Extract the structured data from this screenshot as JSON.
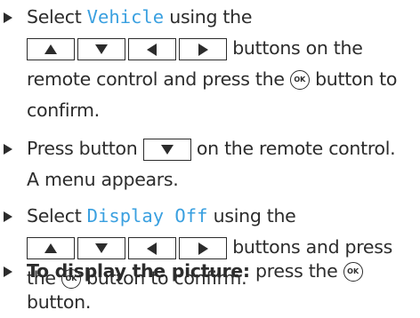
{
  "steps": [
    {
      "line1_prefix": "Select ",
      "term": "Vehicle",
      "line1_suffix": " using the",
      "line2_suffix": " buttons on the",
      "line3_prefix": "remote control and press the ",
      "line3_suffix": " button to",
      "line4": "confirm."
    },
    {
      "line1_prefix": "Press button ",
      "line1_suffix": " on the remote control.",
      "line2": "A menu appears."
    },
    {
      "line1_prefix": "Select ",
      "term": "Display Off",
      "line1_suffix": " using the",
      "line2_suffix": " buttons and press",
      "line3_prefix": "the ",
      "line3_suffix": " button to confirm."
    },
    {
      "bold": "To display the picture:",
      "line1_suffix": " press the ",
      "line2": "button."
    }
  ],
  "ok_label": "OK",
  "icons": {
    "bullet": "bullet-triangle-icon",
    "up": "up-arrow-key-icon",
    "down": "down-arrow-key-icon",
    "left": "left-arrow-key-icon",
    "right": "right-arrow-key-icon",
    "ok": "ok-button-icon"
  },
  "colors": {
    "text": "#2c2c2c",
    "highlight": "#3aa0e0"
  }
}
